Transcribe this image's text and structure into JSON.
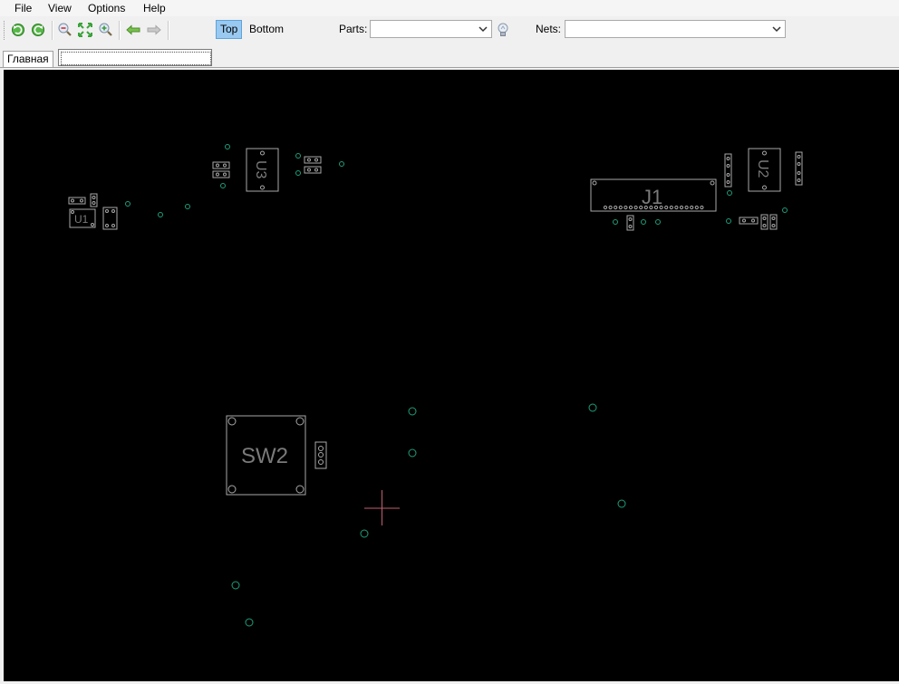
{
  "menu": {
    "file": "File",
    "view": "View",
    "options": "Options",
    "help": "Help"
  },
  "toolbar": {
    "layer_top": "Top",
    "layer_bottom": "Bottom",
    "active_layer": "Top",
    "parts_label": "Parts:",
    "parts_value": "",
    "nets_label": "Nets:",
    "nets_value": ""
  },
  "tabs": {
    "main_tab": "Главная",
    "search_value": ""
  },
  "board": {
    "part_labels": {
      "u1": "U1",
      "u3": "U3",
      "u2": "U2",
      "j1": "J1",
      "sw2": "SW2"
    },
    "colors": {
      "background": "#000000",
      "outline": "#a8a8a8",
      "via": "#1e9e7a",
      "cursor": "#c06070",
      "label": "#7a7a7a"
    }
  }
}
